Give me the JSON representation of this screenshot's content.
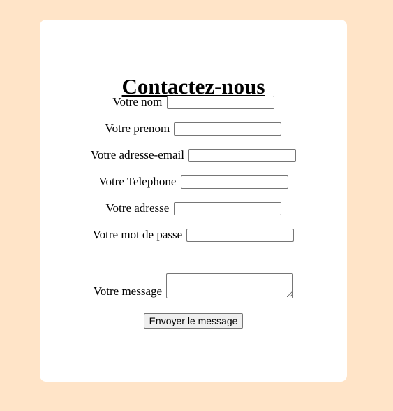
{
  "page": {
    "background_color": "#ffe4c8",
    "card_color": "#ffffff"
  },
  "form": {
    "title": "Contactez-nous",
    "fields": [
      {
        "label": "Votre nom",
        "value": "",
        "placeholder": ""
      },
      {
        "label": "Votre prenom",
        "value": "",
        "placeholder": ""
      },
      {
        "label": "Votre adresse-email",
        "value": "",
        "placeholder": ""
      },
      {
        "label": "Votre Telephone",
        "value": "",
        "placeholder": ""
      },
      {
        "label": "Votre adresse",
        "value": "",
        "placeholder": ""
      },
      {
        "label": "Votre mot de passe",
        "value": "",
        "placeholder": ""
      }
    ],
    "message": {
      "label": "Votre message",
      "value": ""
    },
    "submit_label": "Envoyer le message"
  }
}
